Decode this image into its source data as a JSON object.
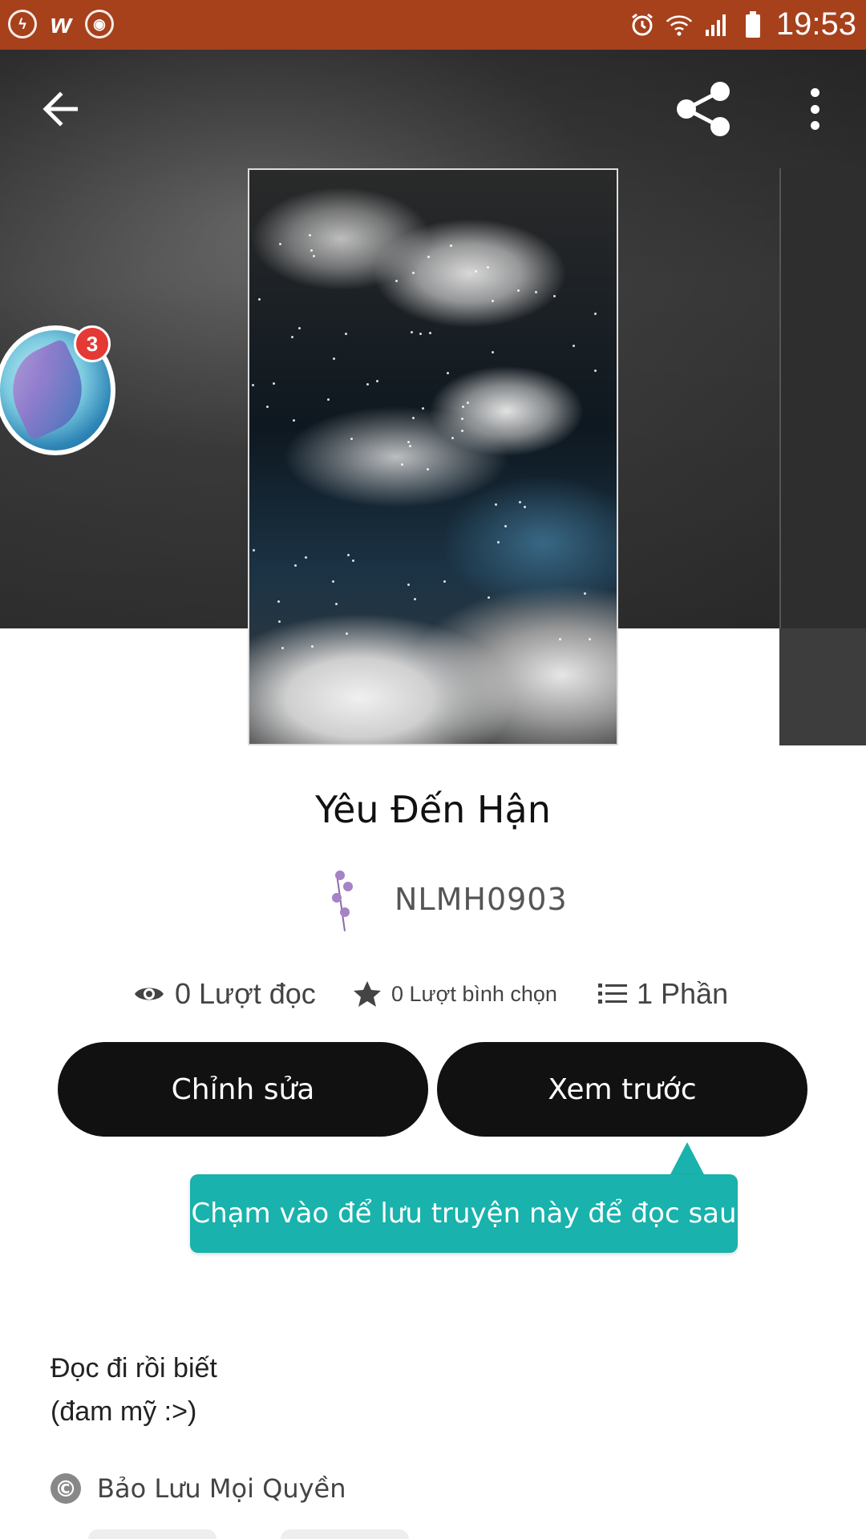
{
  "status_bar": {
    "time": "19:53",
    "left_icons": [
      "messenger-icon",
      "wattpad-icon",
      "chrome-icon"
    ],
    "right_icons": [
      "alarm-icon",
      "wifi-icon",
      "signal-icon",
      "battery-icon"
    ]
  },
  "toolbar": {
    "back_icon": "arrow-left-icon",
    "share_icon": "share-icon",
    "more_icon": "more-vertical-icon"
  },
  "floating_bubble": {
    "badge_count": "3"
  },
  "story": {
    "title": "Yêu Đến Hận",
    "author": "NLMH0903",
    "reads": "0 Lượt đọc",
    "votes": "0 Lượt bình chọn",
    "parts": "1 Phần"
  },
  "actions": {
    "edit_label": "Chỉnh sửa",
    "preview_label": "Xem trước"
  },
  "tooltip": {
    "text": "Chạm vào để lưu truyện này để đọc sau"
  },
  "description": {
    "line1": "Đọc đi rồi biết",
    "line2": "(đam mỹ :>)"
  },
  "copyright": {
    "label": "Bảo Lưu Mọi Quyền"
  },
  "colors": {
    "status_bar": "#a6411c",
    "button": "#111111",
    "tooltip": "#19b2ac",
    "badge": "#e53935"
  }
}
